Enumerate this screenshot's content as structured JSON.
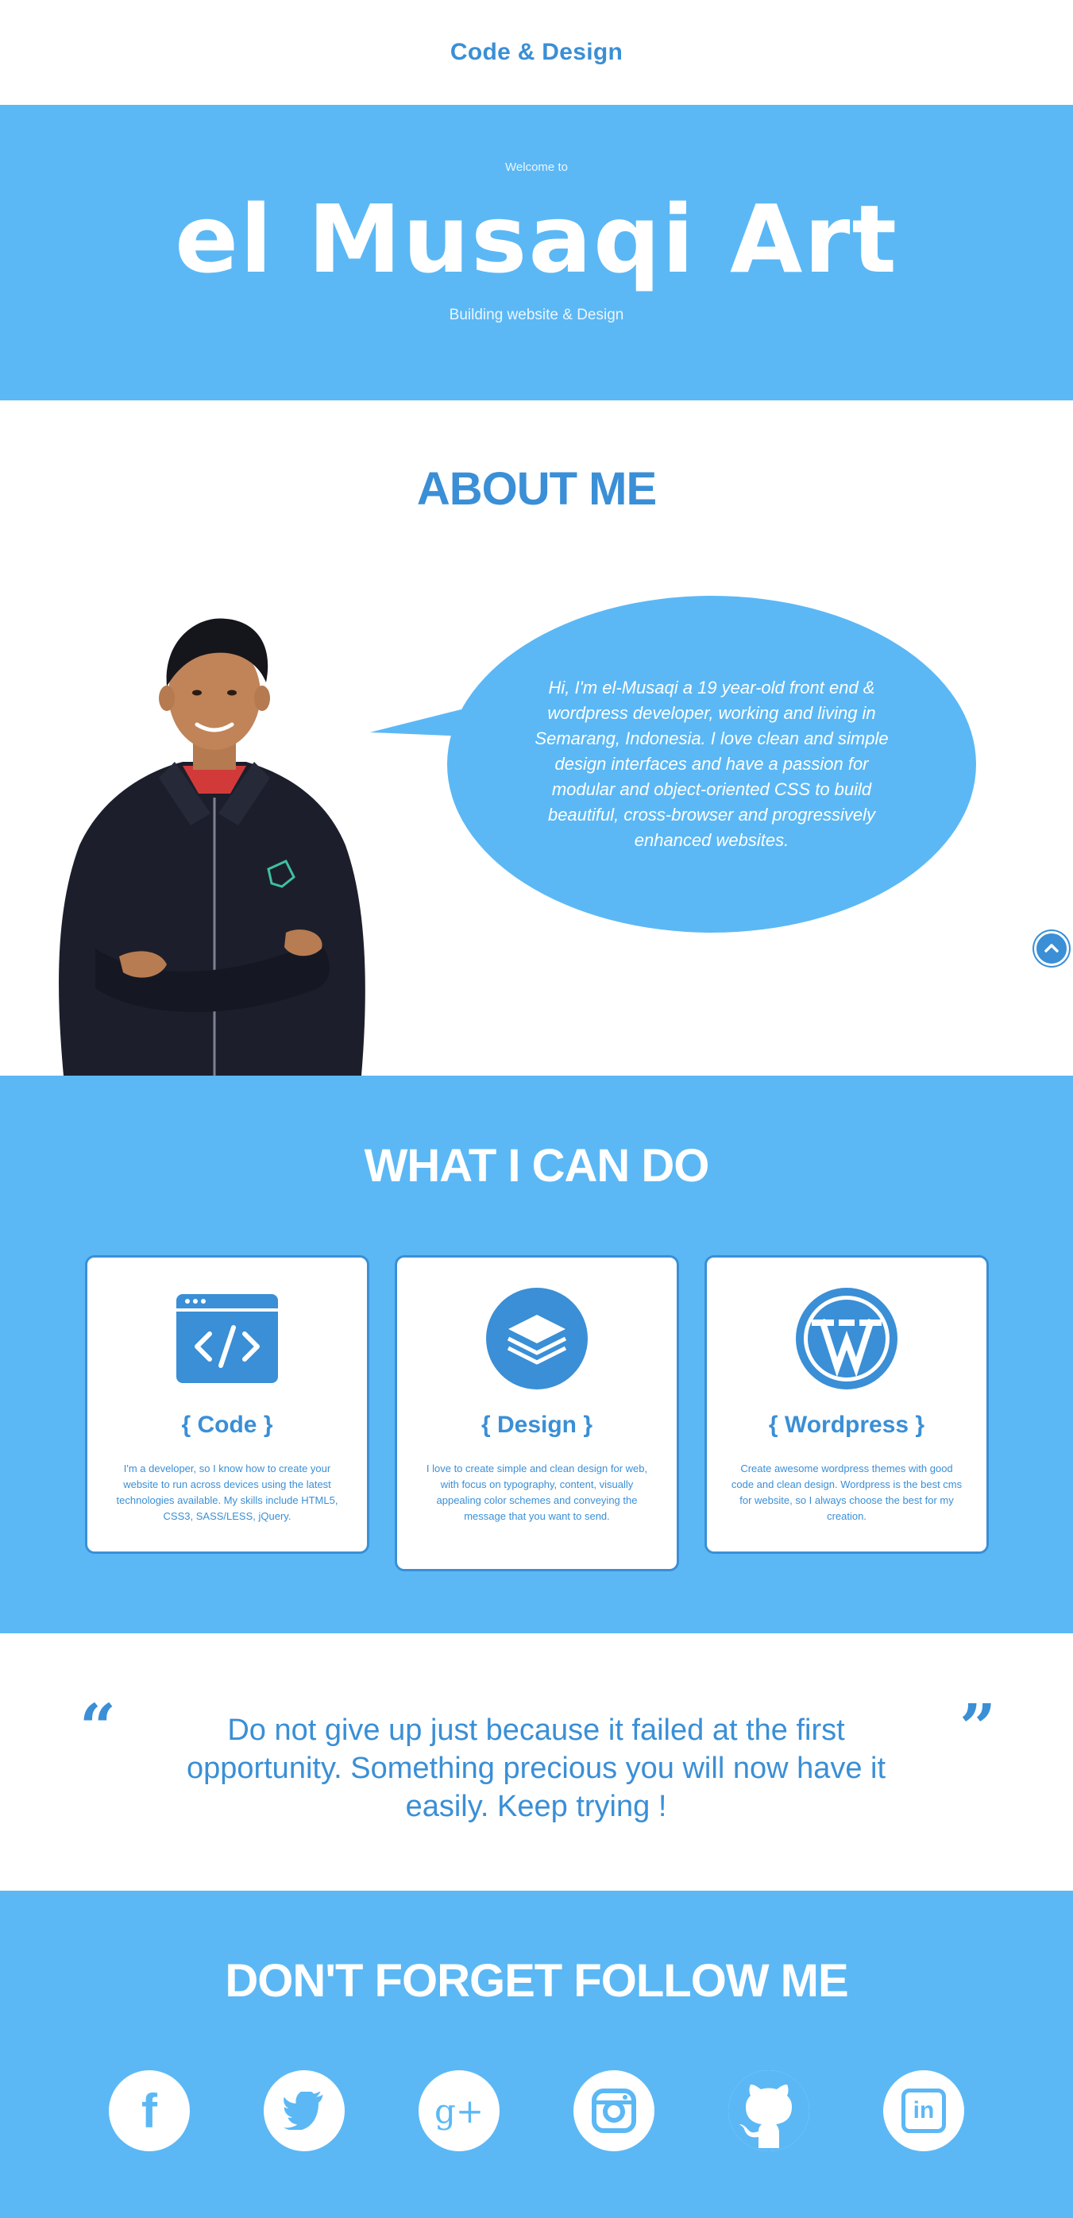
{
  "header": {
    "brand": "Code & Design"
  },
  "hero": {
    "welcome": "Welcome to",
    "name": "el Musaqi Art",
    "tagline": "Building website & Design",
    "background_color": "#5bb8f5"
  },
  "about": {
    "title": "ABOUT ME",
    "bio": "Hi, I'm el-Musaqi a 19 year-old front end & wordpress developer, working and living in Semarang, Indonesia. I love clean and simple design interfaces and have a passion for modular and object-oriented CSS to build beautiful, cross-browser and progressively enhanced websites.",
    "portrait_icon": "person-portrait"
  },
  "skills": {
    "title": "WHAT I CAN DO",
    "cards": [
      {
        "icon": "code-window-icon",
        "title": "{ Code }",
        "text": "I'm a developer, so I know how to create your website to run across devices using the latest technologies available. My skills include HTML5, CSS3, SASS/LESS, jQuery."
      },
      {
        "icon": "layers-icon",
        "title": "{ Design }",
        "text": "I love to create simple and clean design for web, with focus on typography, content, visually appealing color schemes and conveying the message that you want to send."
      },
      {
        "icon": "wordpress-icon",
        "title": "{ Wordpress }",
        "text": "Create awesome wordpress themes with good code and clean design. Wordpress is the best cms for website, so I always choose the best for my creation."
      }
    ]
  },
  "quote": {
    "open_mark": "“",
    "close_mark": "”",
    "text": "Do not give up just because it failed at the first opportunity. Something precious you will now have it easily. Keep trying !"
  },
  "follow": {
    "title": "DON'T FORGET FOLLOW ME",
    "networks": [
      {
        "name": "facebook",
        "icon": "facebook-icon",
        "glyph": "f"
      },
      {
        "name": "twitter",
        "icon": "twitter-icon",
        "glyph": ""
      },
      {
        "name": "google-plus",
        "icon": "google-plus-icon",
        "glyph": "g+"
      },
      {
        "name": "instagram",
        "icon": "instagram-icon",
        "glyph": ""
      },
      {
        "name": "github",
        "icon": "github-icon",
        "glyph": ""
      },
      {
        "name": "linkedin",
        "icon": "linkedin-icon",
        "glyph": "in"
      }
    ]
  },
  "colors": {
    "primary": "#3a8fd6",
    "accent_bg": "#5bb8f5",
    "text_light": "#ffffff"
  }
}
